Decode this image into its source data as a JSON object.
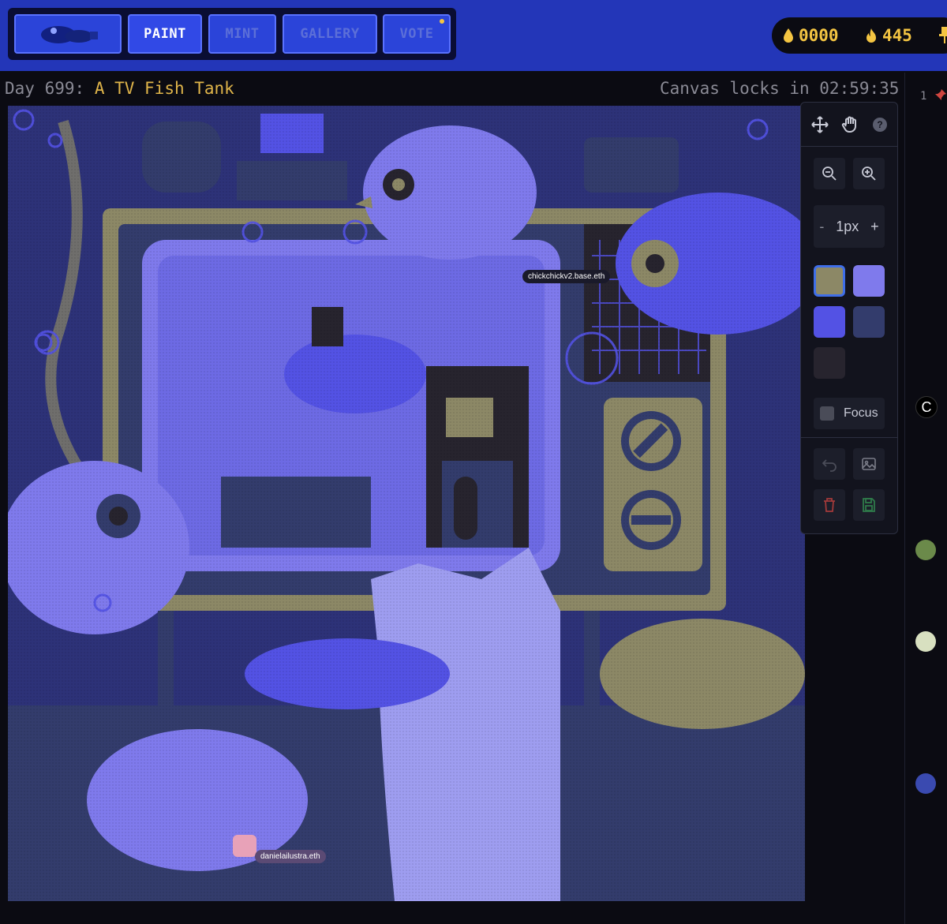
{
  "nav": {
    "logo_label": "",
    "buttons": [
      {
        "label": "PAINT",
        "active": true
      },
      {
        "label": "MINT",
        "active": false
      },
      {
        "label": "GALLERY",
        "active": false
      },
      {
        "label": "VOTE",
        "active": false
      }
    ]
  },
  "stats": {
    "drops": "0000",
    "fire": "445"
  },
  "header": {
    "day_prefix": "Day 699:",
    "theme": "A TV Fish Tank",
    "locks_text": "Canvas locks in 02:59:35"
  },
  "canvas": {
    "users": [
      {
        "name": "chickchickv2.base.eth"
      },
      {
        "name": "danielailustra.eth"
      }
    ]
  },
  "tools": {
    "pixel_size": "1px",
    "minus": "-",
    "plus": "+",
    "focus_label": "Focus",
    "help": "?",
    "palette": [
      "#8c8866",
      "#7f7aec",
      "#5352e4",
      "#333c6c",
      "#27242e"
    ]
  },
  "right": {
    "line_number": "1",
    "letter": "C"
  },
  "colors": {
    "accent": "#2336b8",
    "gold": "#f4c542"
  }
}
